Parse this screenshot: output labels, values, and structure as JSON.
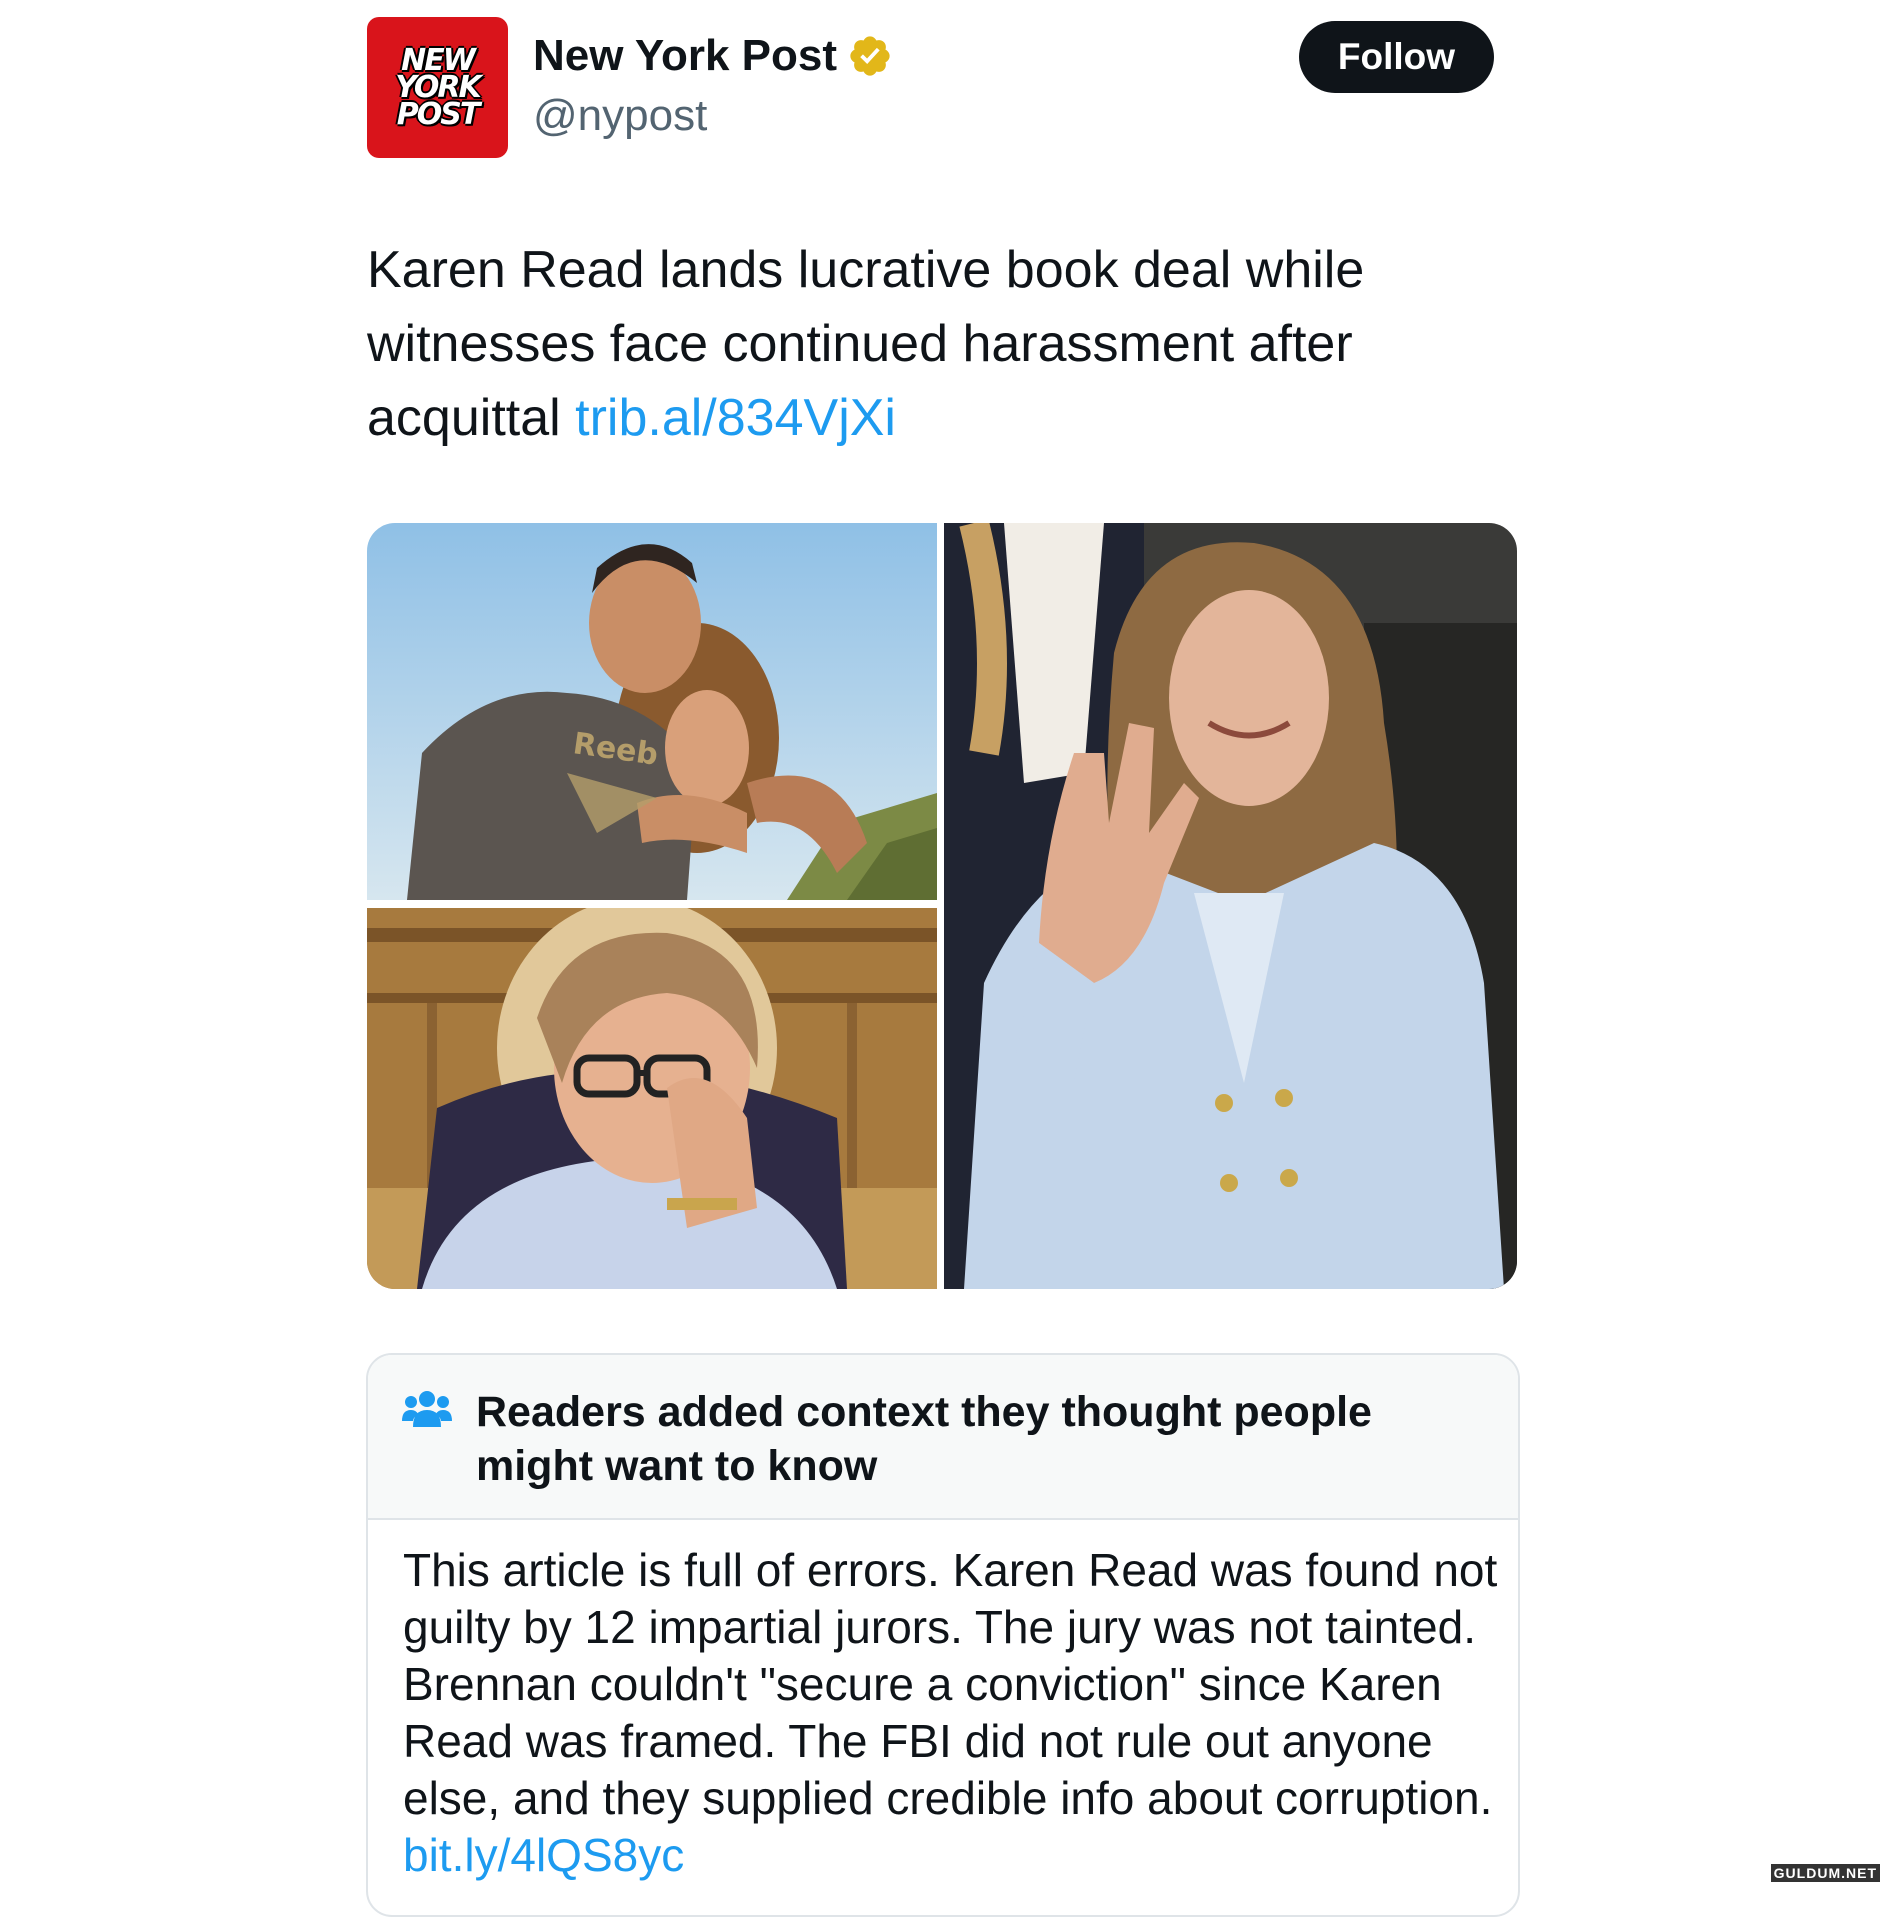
{
  "account": {
    "avatar_logo": [
      "NEW",
      "YORK",
      "POST"
    ],
    "display_name": "New York Post",
    "verified_badge": "gold-verified-icon",
    "handle": "@nypost"
  },
  "follow_label": "Follow",
  "tweet": {
    "text": "Karen Read lands lucrative book deal while witnesses face continued harassment after acquittal ",
    "link": "trib.al/834VjXi"
  },
  "media": {
    "photo_1_print": "Reeb"
  },
  "community_note": {
    "title": "Readers added context they thought people might want to know",
    "body": "This article is full of errors. Karen Read was found not guilty by 12 impartial jurors. The jury was not tainted. Brennan couldn't \"secure a conviction\" since Karen Read was framed. The FBI did not rule out anyone else, and they supplied credible info about corruption. ",
    "link": "bit.ly/4lQS8yc"
  },
  "watermark": "GULDUM.NET",
  "colors": {
    "accent": "#1d9bf0",
    "avatar_red": "#d9141b",
    "verified_gold": "#e2b719",
    "button_black": "#0f1419",
    "handle_gray": "#536471"
  }
}
